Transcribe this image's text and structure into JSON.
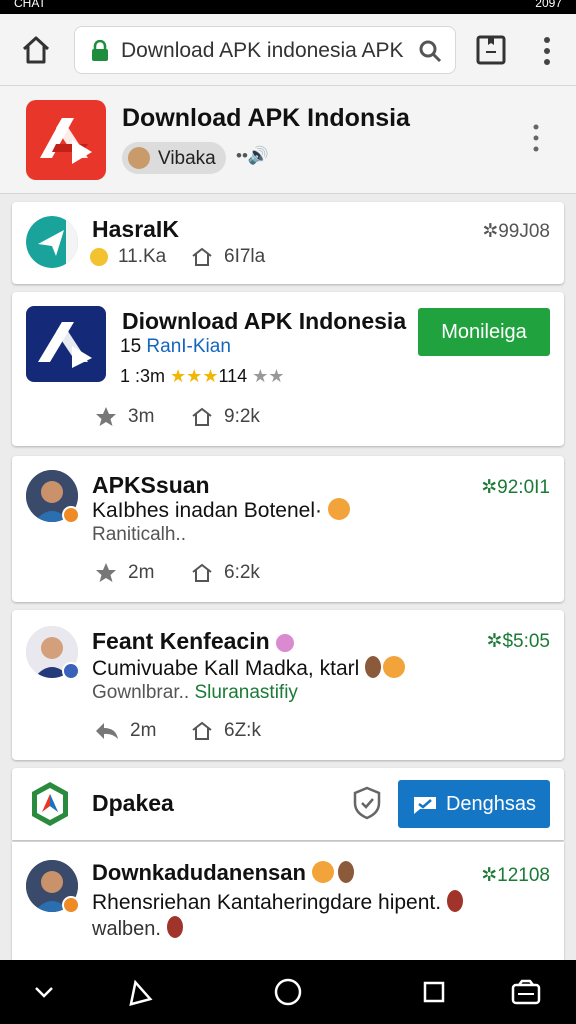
{
  "status_bar": {
    "left_text": "CHAT",
    "right_text": "2097"
  },
  "browser": {
    "url": "Download APK indonesia APK"
  },
  "app_header": {
    "title": "Download APK Indonsia",
    "author": "Vibaka",
    "extra": "••🔊"
  },
  "colors": {
    "accent_green": "#20a33e",
    "accent_blue": "#1476c4",
    "timestamp_green": "#1b7a36",
    "app_red": "#e8362a",
    "app_navy": "#142a78",
    "star_yellow": "#f2b705"
  },
  "feed": {
    "post1": {
      "name": "HasraIK",
      "timestamp": "✲99J08",
      "stat": "11.Ka",
      "reshares": "6I7la"
    },
    "app_card": {
      "name": "Diownload APK Indonesia",
      "subtitle_prefix": "15",
      "subtitle_link": "RanI-Kian",
      "rating_prefix": "1 :3m",
      "rating_stars": "★★★",
      "rating_count": "114",
      "rating_empty_stars": "★★",
      "action_button": "Monileiga",
      "favorites": "3m",
      "reshares": "9:2k"
    },
    "post2": {
      "name": "APKSsuan",
      "timestamp": "✲92:0I1",
      "text": "KaIbhes inadan Botenel·",
      "subtext": "Raniticalh..",
      "favorites": "2m",
      "reshares": "6:2k"
    },
    "post3": {
      "name": "Feant Kenfeacin",
      "timestamp": "✲$5:05",
      "text": "Cumivuabe Kall Madka, ktarl",
      "subtext": "Gownlbrar..",
      "subtext_link": "Sluranastifiy",
      "replies": "2m",
      "reshares": "6Z:k"
    },
    "post4": {
      "name": "Dpakea",
      "action_button": "Denghsas"
    },
    "post5": {
      "name": "Downkadudanensan",
      "timestamp": "✲12108",
      "text": "Rhensriehan Kantaheringdare hipent.",
      "subtext": "walben."
    }
  }
}
